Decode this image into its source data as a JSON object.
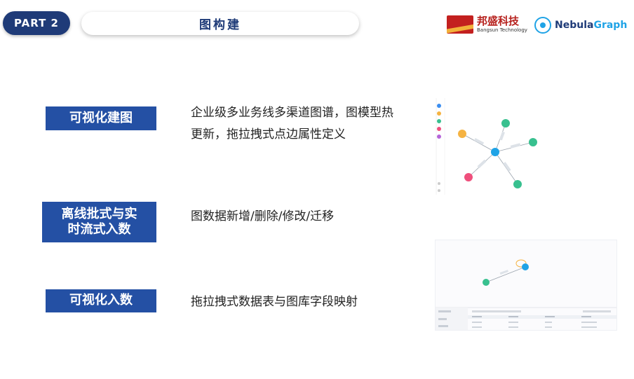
{
  "header": {
    "part_label": "PART 2",
    "title": "图构建",
    "logo_bangsun": {
      "cn": "邦盛科技",
      "en": "Bangsun Technology"
    },
    "logo_nebula": {
      "prefix": "Nebula",
      "suffix": "Graph"
    }
  },
  "features": [
    {
      "label": "可视化建图",
      "desc": "企业级多业务线多渠道图谱，图模型热更新，拖拉拽式点边属性定义"
    },
    {
      "label": "离线批式与实时流式入数",
      "desc": "图数据新增/删除/修改/迁移"
    },
    {
      "label": "可视化入数",
      "desc": "拖拉拽式数据表与图库字段映射"
    }
  ],
  "colors": {
    "brand_blue": "#2450a4",
    "dark_blue": "#1f3b78",
    "nebula_blue": "#1fa3e6",
    "bangsun_red": "#c3201f"
  }
}
